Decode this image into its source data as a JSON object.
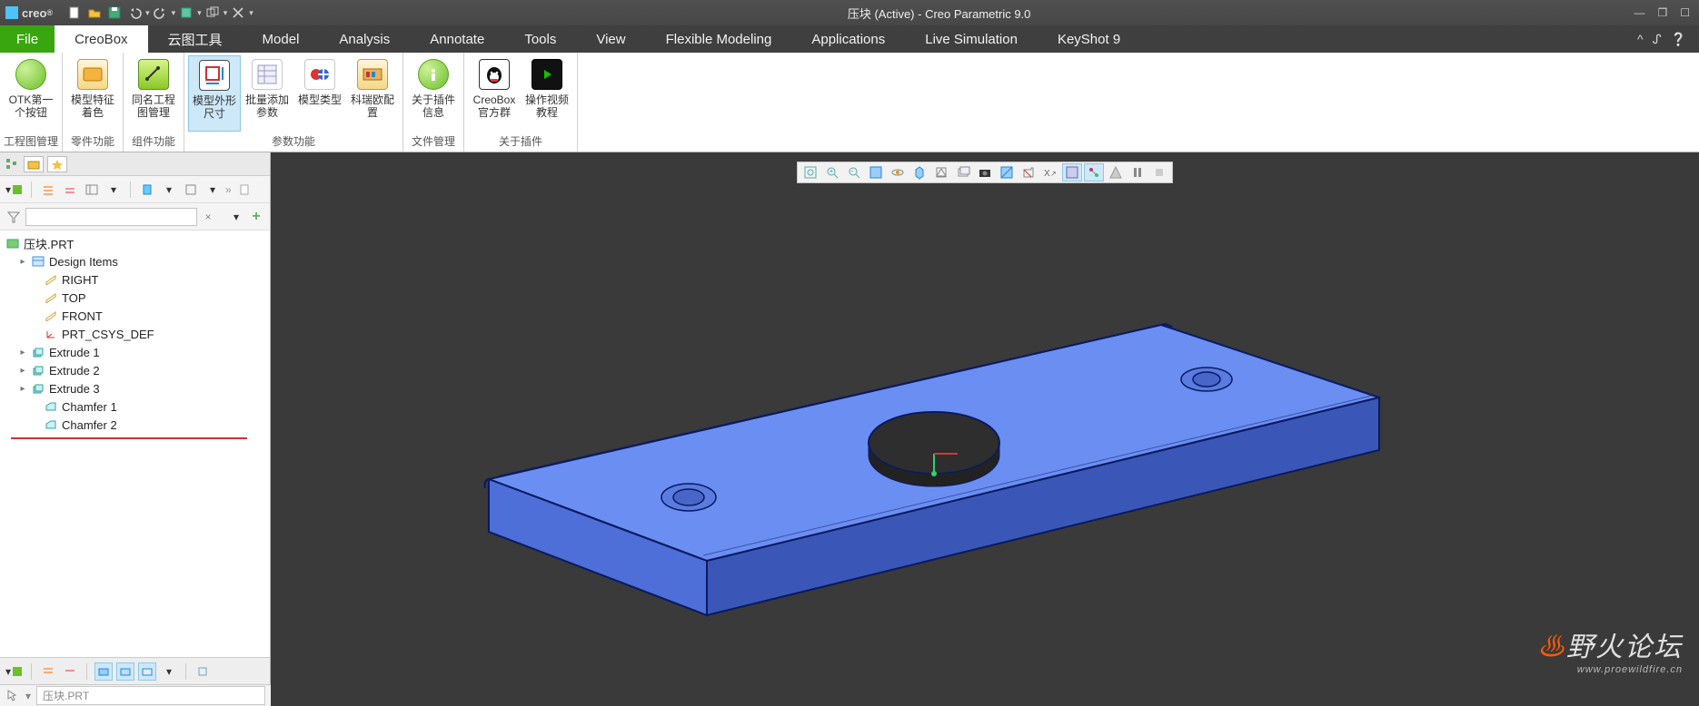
{
  "app": {
    "logo": "creo",
    "title": "压块 (Active) - Creo Parametric 9.0"
  },
  "quick_access": [
    "new",
    "open",
    "save",
    "save-all",
    "undo",
    "redo",
    "regen",
    "windows",
    "close"
  ],
  "tabs": {
    "file": "File",
    "items": [
      "CreoBox",
      "云图工具",
      "Model",
      "Analysis",
      "Annotate",
      "Tools",
      "View",
      "Flexible Modeling",
      "Applications",
      "Live Simulation",
      "KeyShot 9"
    ],
    "active": "CreoBox"
  },
  "ribbon": [
    {
      "label": "工程图管理",
      "buttons": [
        {
          "id": "otk",
          "label": "OTK第一个按钮"
        }
      ]
    },
    {
      "label": "零件功能",
      "buttons": [
        {
          "id": "mdlcolor",
          "label": "模型特征着色"
        }
      ]
    },
    {
      "label": "组件功能",
      "buttons": [
        {
          "id": "samedrw",
          "label": "同名工程图管理"
        }
      ]
    },
    {
      "label": "参数功能",
      "buttons": [
        {
          "id": "outdim",
          "label": "模型外形尺寸",
          "hl": true
        },
        {
          "id": "batchparam",
          "label": "批量添加参数"
        },
        {
          "id": "mdltype",
          "label": "模型类型"
        },
        {
          "id": "krocfg",
          "label": "科瑞欧配置"
        }
      ]
    },
    {
      "label": "文件管理",
      "buttons": [
        {
          "id": "aboutplugin",
          "label": "关于插件信息"
        }
      ]
    },
    {
      "label": "关于插件",
      "buttons": [
        {
          "id": "qqgroup",
          "label": "CreoBox官方群"
        },
        {
          "id": "optutorial",
          "label": "操作视频教程"
        }
      ]
    }
  ],
  "tree": {
    "root": "压块.PRT",
    "items": [
      {
        "label": "Design Items",
        "icon": "design",
        "exp": "▸"
      },
      {
        "label": "RIGHT",
        "icon": "plane"
      },
      {
        "label": "TOP",
        "icon": "plane"
      },
      {
        "label": "FRONT",
        "icon": "plane"
      },
      {
        "label": "PRT_CSYS_DEF",
        "icon": "csys"
      },
      {
        "label": "Extrude 1",
        "icon": "extrude",
        "exp": "▸"
      },
      {
        "label": "Extrude 2",
        "icon": "extrude",
        "exp": "▸"
      },
      {
        "label": "Extrude 3",
        "icon": "extrude",
        "exp": "▸"
      },
      {
        "label": "Chamfer 1",
        "icon": "chamfer"
      },
      {
        "label": "Chamfer 2",
        "icon": "chamfer"
      }
    ]
  },
  "status": {
    "label": "压块.PRT"
  },
  "viewtools": [
    "refit",
    "zoom-in",
    "zoom-out",
    "orient",
    "spin",
    "view-mgr",
    "cube",
    "saved-views",
    "camera",
    "appearance",
    "section",
    "x-sec",
    "layers-vis",
    "annot-vis",
    "warn",
    "pause",
    "stop"
  ],
  "search": {
    "placeholder": ""
  },
  "watermark": {
    "text": "野火论坛",
    "url": "www.proewildfire.cn"
  }
}
